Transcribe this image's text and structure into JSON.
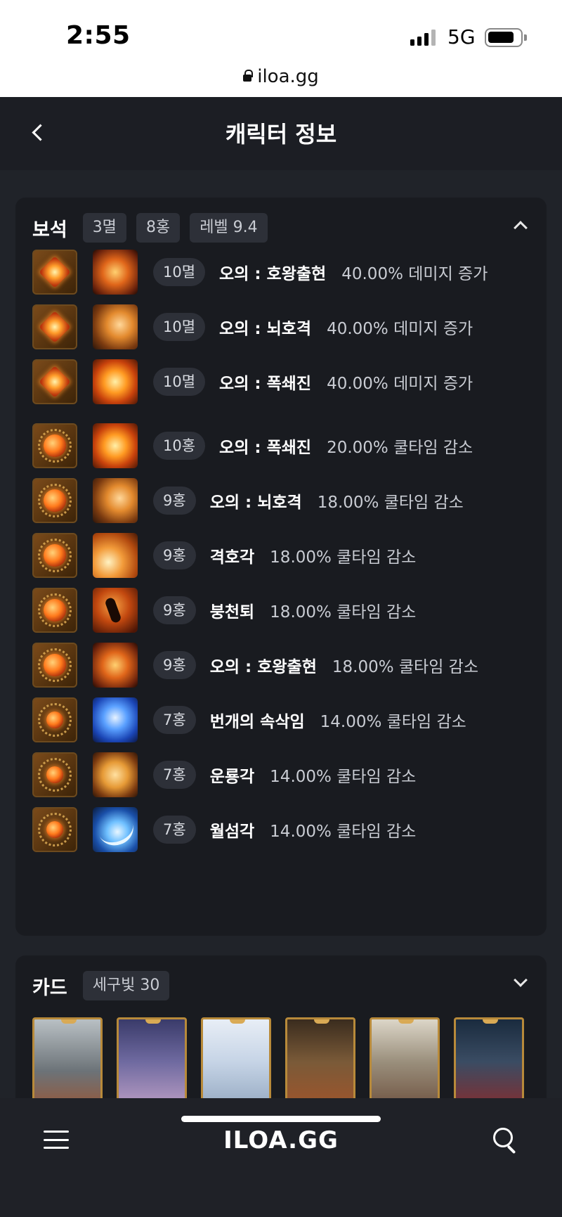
{
  "status": {
    "time": "2:55",
    "network": "5G"
  },
  "browser": {
    "url": "iloa.gg"
  },
  "header": {
    "title": "캐릭터 정보"
  },
  "gems_section": {
    "title": "보석",
    "tags": [
      "3멸",
      "8홍",
      "레벨 9.4"
    ],
    "rows": [
      {
        "gem": "myeol",
        "skill_icon": "s-storm",
        "level": "10멸",
        "skill": "오의 : 호왕출현",
        "effect": "40.00% 데미지 증가"
      },
      {
        "gem": "myeol",
        "skill_icon": "s-tiger",
        "level": "10멸",
        "skill": "오의 : 뇌호격",
        "effect": "40.00% 데미지 증가"
      },
      {
        "gem": "myeol",
        "skill_icon": "s-fire",
        "level": "10멸",
        "skill": "오의 : 폭쇄진",
        "effect": "40.00% 데미지 증가"
      },
      {
        "gem": "hong",
        "skill_icon": "s-fire",
        "level": "10홍",
        "skill": "오의 : 폭쇄진",
        "effect": "20.00% 쿨타임 감소"
      },
      {
        "gem": "hong",
        "skill_icon": "s-tiger",
        "level": "9홍",
        "skill": "오의 : 뇌호격",
        "effect": "18.00% 쿨타임 감소"
      },
      {
        "gem": "hong",
        "skill_icon": "s-slash",
        "level": "9홍",
        "skill": "격호각",
        "effect": "18.00% 쿨타임 감소"
      },
      {
        "gem": "hong",
        "skill_icon": "s-kick",
        "level": "9홍",
        "skill": "붕천퇴",
        "effect": "18.00% 쿨타임 감소"
      },
      {
        "gem": "hong",
        "skill_icon": "s-storm",
        "level": "9홍",
        "skill": "오의 : 호왕출현",
        "effect": "18.00% 쿨타임 감소"
      },
      {
        "gem": "hong-small",
        "skill_icon": "s-lightning",
        "level": "7홍",
        "skill": "번개의 속삭임",
        "effect": "14.00% 쿨타임 감소"
      },
      {
        "gem": "hong-small",
        "skill_icon": "s-dragon",
        "level": "7홍",
        "skill": "운룡각",
        "effect": "14.00% 쿨타임 감소"
      },
      {
        "gem": "hong-small",
        "skill_icon": "s-moon",
        "level": "7홍",
        "skill": "월섬각",
        "effect": "14.00% 쿨타임 감소"
      }
    ]
  },
  "cards_section": {
    "title": "카드",
    "tag": "세구빛 30"
  },
  "bottom_nav": {
    "brand": "ILOA.GG"
  }
}
